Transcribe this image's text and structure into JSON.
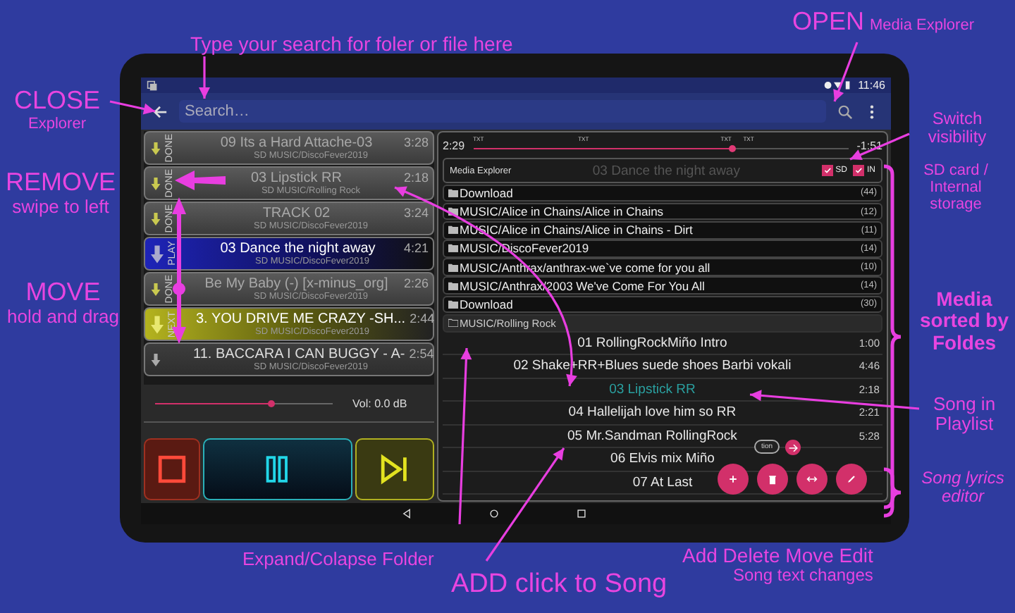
{
  "status_bar": {
    "time": "11:46"
  },
  "app_bar": {
    "placeholder": "Search…"
  },
  "playlist": [
    {
      "kind": "done",
      "status": "DONE",
      "title": "09 Its a Hard Attache-03",
      "time": "3:28",
      "path": "SD MUSIC/DiscoFever2019"
    },
    {
      "kind": "done",
      "status": "DONE",
      "title": "03 Lipstick RR",
      "time": "2:18",
      "path": "SD MUSIC/Rolling Rock"
    },
    {
      "kind": "done",
      "status": "DONE",
      "title": "TRACK 02",
      "time": "3:24",
      "path": "SD MUSIC/DiscoFever2019"
    },
    {
      "kind": "play",
      "status": "PLAY",
      "title": "03 Dance the night away",
      "time": "4:21",
      "path": "SD MUSIC/DiscoFever2019"
    },
    {
      "kind": "done",
      "status": "DONE",
      "title": "Be My Baby (-) [x-minus_org]",
      "time": "2:26",
      "path": "SD MUSIC/DiscoFever2019"
    },
    {
      "kind": "next",
      "status": "NEXT",
      "title": "3. YOU DRIVE ME CRAZY -SH...",
      "time": "2:44",
      "path": "SD MUSIC/DiscoFever2019"
    },
    {
      "kind": "queued",
      "title": "11. BACCARA I CAN BUGGY - A-",
      "time": "2:54",
      "path": "SD MUSIC/DiscoFever2019"
    }
  ],
  "volume": {
    "level": 0.65,
    "reading": "Vol: 0.0 dB"
  },
  "transport": [
    {
      "kind": "stop"
    },
    {
      "kind": "pause"
    },
    {
      "kind": "next"
    }
  ],
  "timeline": {
    "elapsed": "2:29",
    "remaining": "-1:51",
    "level": 0.69,
    "markers": [
      "TXT",
      "TXT",
      "TXT",
      "TXT"
    ]
  },
  "explorer": {
    "title": "Media Explorer",
    "now_playing": "03 Dance the night away",
    "storage": [
      {
        "label": "SD",
        "checked": true
      },
      {
        "label": "IN",
        "checked": true
      }
    ],
    "folders": [
      {
        "name": "Download",
        "count": "(44)",
        "expanded": false
      },
      {
        "name": "MUSIC/Alice in Chains/Alice in Chains",
        "count": "(12)",
        "expanded": false
      },
      {
        "name": "MUSIC/Alice in Chains/Alice in Chains - Dirt",
        "count": "(11)",
        "expanded": false
      },
      {
        "name": "MUSIC/DiscoFever2019",
        "count": "(14)",
        "expanded": false
      },
      {
        "name": "MUSIC/Anthrax/anthrax-we`ve come for you all",
        "count": "(10)",
        "expanded": false
      },
      {
        "name": "MUSIC/Anthrax/2003 We've Come For You All",
        "count": "(14)",
        "expanded": false
      },
      {
        "name": "Download",
        "count": "(30)",
        "expanded": false
      },
      {
        "name": "MUSIC/Rolling Rock",
        "expanded": true,
        "children": [
          {
            "title": "01 RollingRockMiño Intro",
            "time": "1:00",
            "selected": false
          },
          {
            "title": "02 Shake+RR+Blues suede shoes Barbi vokali",
            "time": "4:46",
            "selected": false
          },
          {
            "title": "03 Lipstick RR",
            "time": "2:18",
            "selected": true
          },
          {
            "title": "04 Hallelijah love him so RR",
            "time": "2:21",
            "selected": false
          },
          {
            "title": "05 Mr.Sandman RollingRock",
            "time": "5:28",
            "selected": false
          },
          {
            "title": "06 Elvis mix Miño",
            "selected": false
          },
          {
            "title": "07 At Last",
            "selected": false
          }
        ]
      }
    ],
    "option_chip": "tion",
    "actions": [
      {
        "kind": "add"
      },
      {
        "kind": "delete"
      },
      {
        "kind": "move"
      },
      {
        "kind": "edit"
      }
    ]
  },
  "annotations": [
    {
      "kind": "note",
      "text": "Type your search for foler or file here"
    },
    {
      "kind": "heading",
      "text": "OPEN",
      "subtitle": "Media Explorer"
    },
    {
      "kind": "heading",
      "text": "CLOSE",
      "subtitle": "Explorer"
    },
    {
      "kind": "note",
      "text": "Switch visibility"
    },
    {
      "kind": "heading",
      "text": "REMOVE",
      "subtitle": "swipe to left"
    },
    {
      "kind": "small",
      "text": "SD card / Internal storage"
    },
    {
      "kind": "heading",
      "text": "MOVE",
      "subtitle": "hold and drag"
    },
    {
      "kind": "strong",
      "text": "Media sorted by Foldes"
    },
    {
      "kind": "note",
      "text": "Song in Playlist"
    },
    {
      "kind": "italic",
      "text": "Song lyrics editor"
    },
    {
      "kind": "note",
      "text": "Expand/Colapse Folder"
    },
    {
      "kind": "heading",
      "text": "Add Delete Move Edit",
      "subtitle": "Song text changes"
    },
    {
      "kind": "big",
      "text": "ADD click to Song"
    }
  ]
}
